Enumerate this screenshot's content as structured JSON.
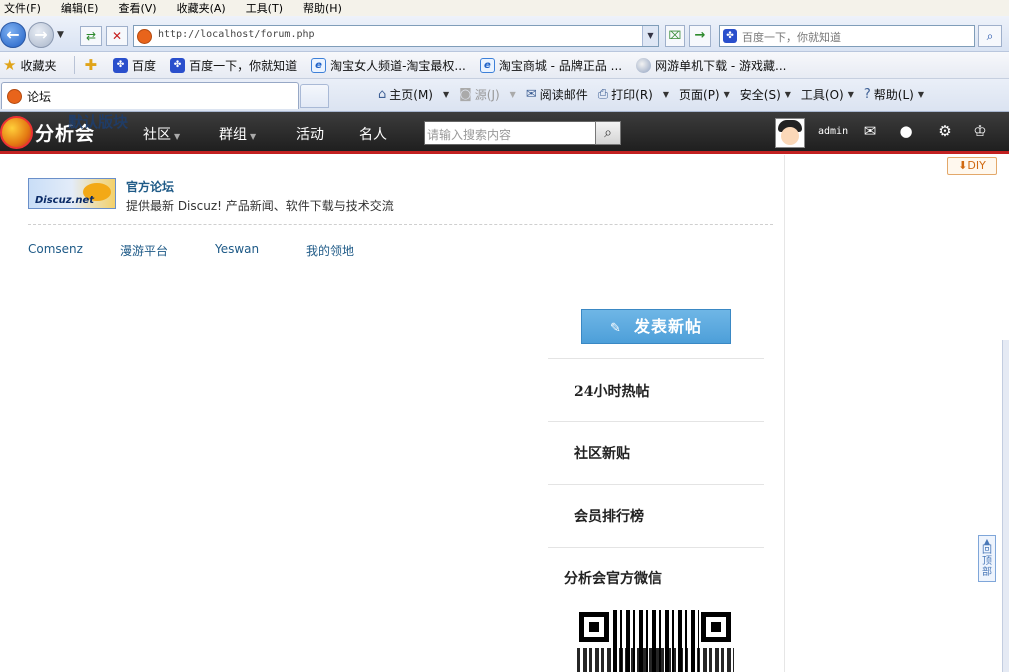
{
  "browser": {
    "menu": [
      "文件(F)",
      "编辑(E)",
      "查看(V)",
      "收藏夹(A)",
      "工具(T)",
      "帮助(H)"
    ],
    "url": "http://localhost/forum.php",
    "search_placeholder": "百度一下，你就知道",
    "favorites_label": "收藏夹",
    "favorites": [
      "百度",
      "百度一下，你就知道",
      "淘宝女人频道-淘宝最权...",
      "淘宝商城 - 品牌正品 ...",
      "网游单机下载 - 游戏藏..."
    ],
    "tab_title": "论坛",
    "commands": {
      "home": "主页(M)",
      "feeds": "源(J)",
      "read_mail": "阅读邮件",
      "print": "打印(R)",
      "page": "页面(P)",
      "safety": "安全(S)",
      "tools": "工具(O)",
      "help": "帮助(L)"
    }
  },
  "header": {
    "logo_text": "分析会",
    "ghost_text": "默认版块",
    "nav": [
      "社区",
      "群组",
      "活动",
      "名人"
    ],
    "search_placeholder": "请输入搜索内容",
    "username": "admin"
  },
  "diy_label": "DIY",
  "block": {
    "logo_text": "Discuz.net",
    "title": "官方论坛",
    "desc": "提供最新 Discuz! 产品新闻、软件下载与技术交流"
  },
  "friend_links": [
    "Comsenz",
    "漫游平台",
    "Yeswan",
    "我的领地"
  ],
  "sidebar": {
    "post_button": "发表新帖",
    "items": [
      "24小时热帖",
      "社区新贴",
      "会员排行榜"
    ],
    "wechat_title": "分析会官方微信"
  },
  "back_to_top": "回顶部"
}
